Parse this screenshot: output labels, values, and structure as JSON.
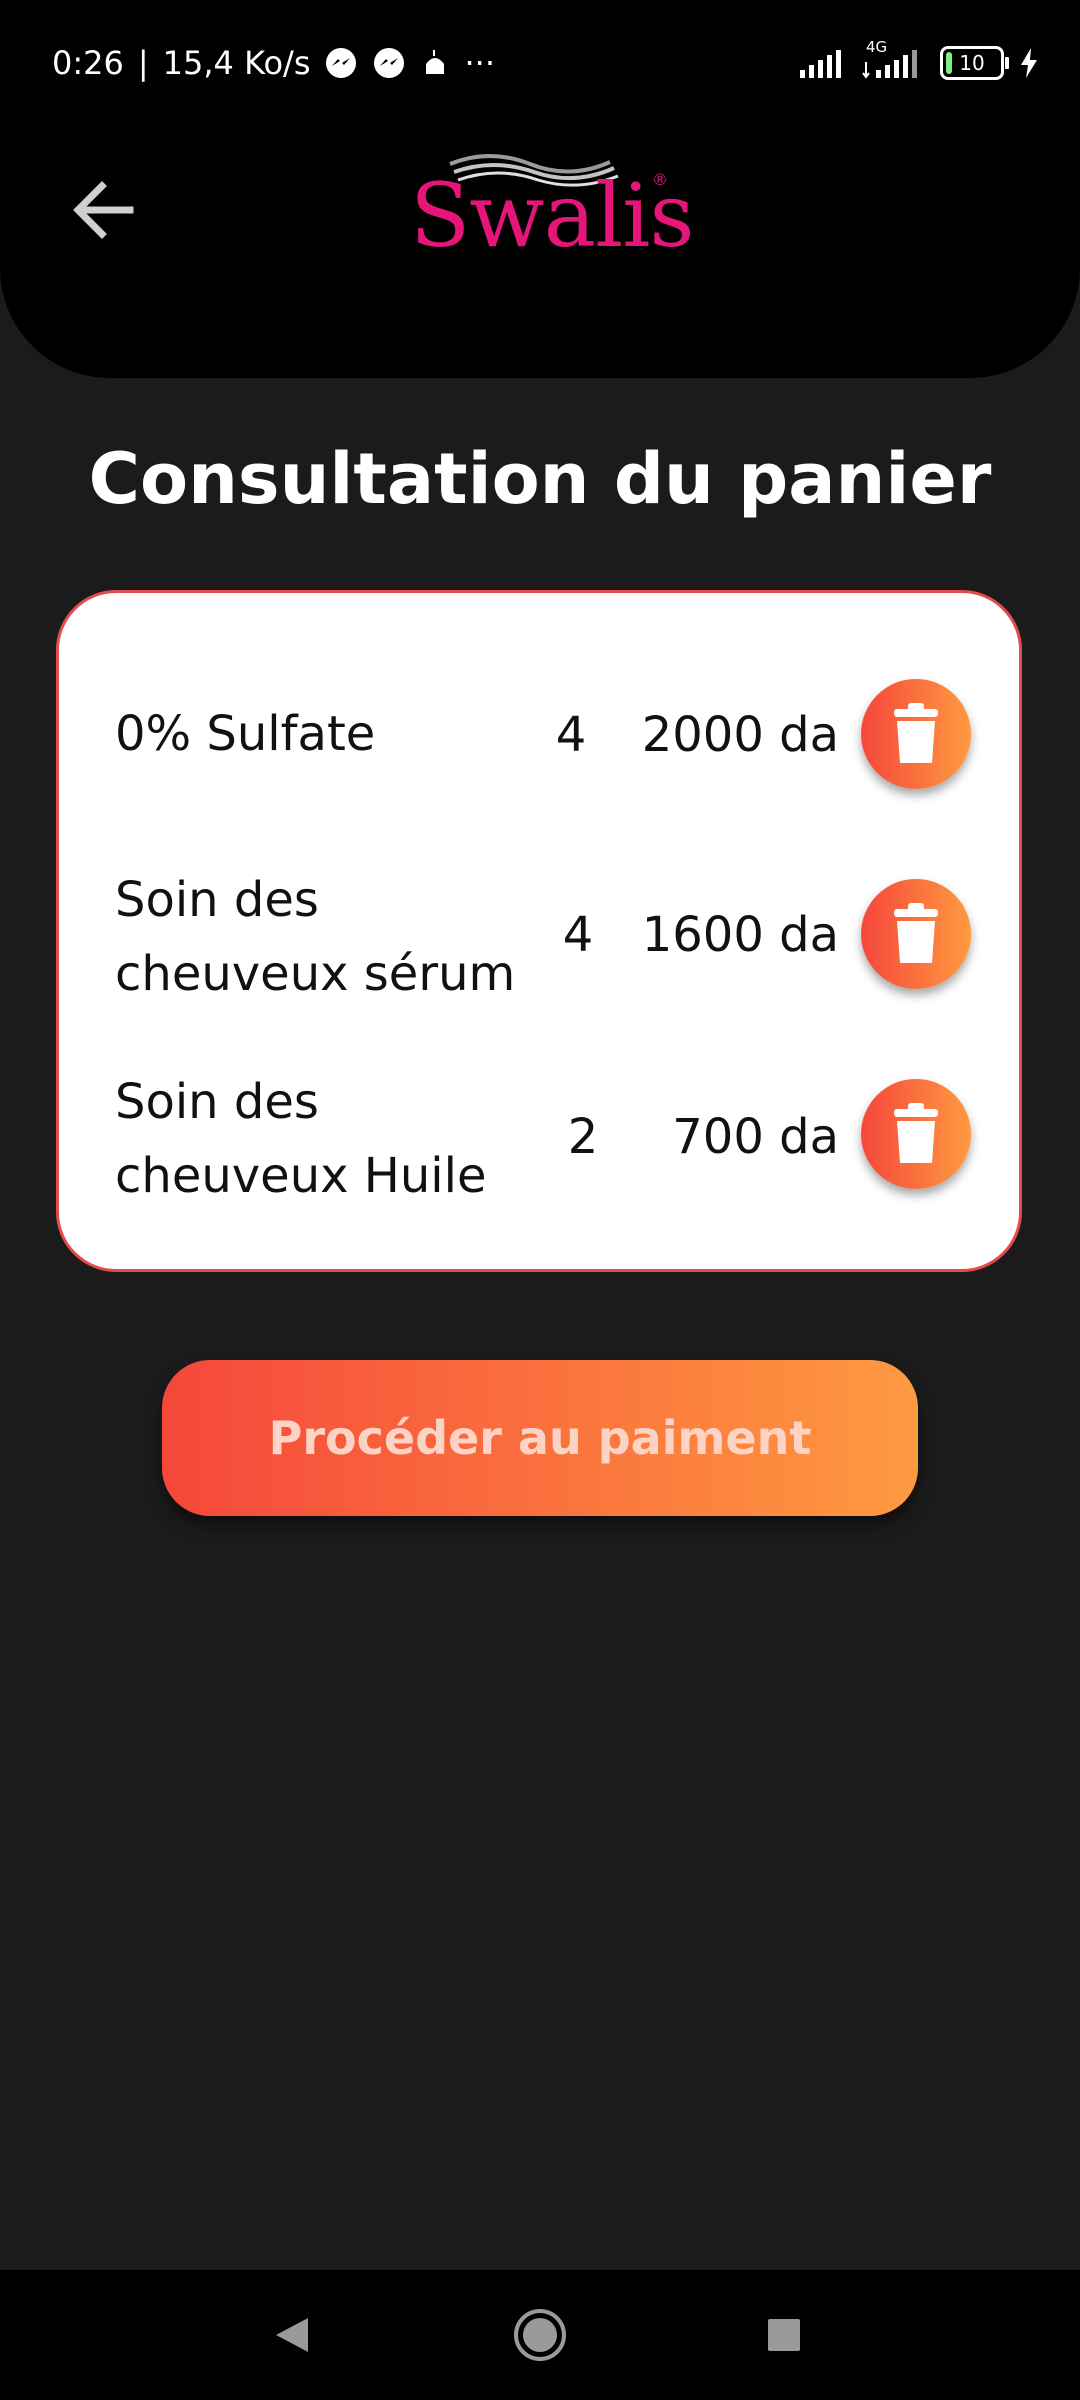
{
  "status_bar": {
    "time": "0:26",
    "separator": "|",
    "speed": "15,4 Ko/s",
    "dots": "···",
    "network": "4G",
    "battery": "10"
  },
  "header": {
    "logo_text": "Swalis",
    "logo_mark": "®",
    "back_icon": "arrow-left-icon"
  },
  "page": {
    "title": "Consultation du panier"
  },
  "cart": {
    "items": [
      {
        "name": "0% Sulfate",
        "qty": "4",
        "price": "2000 da"
      },
      {
        "name": "Soin des cheuveux sérum",
        "qty": "4",
        "price": "1600 da"
      },
      {
        "name": "Soin des cheuveux Huile",
        "qty": "2",
        "price": "700 da"
      }
    ]
  },
  "checkout": {
    "label": "Procéder au paiment"
  },
  "colors": {
    "brand": "#e5157a",
    "accent_start": "#f5473b",
    "accent_end": "#ff9a40",
    "card_border": "#e24c4c",
    "background": "#1b1b1b"
  }
}
